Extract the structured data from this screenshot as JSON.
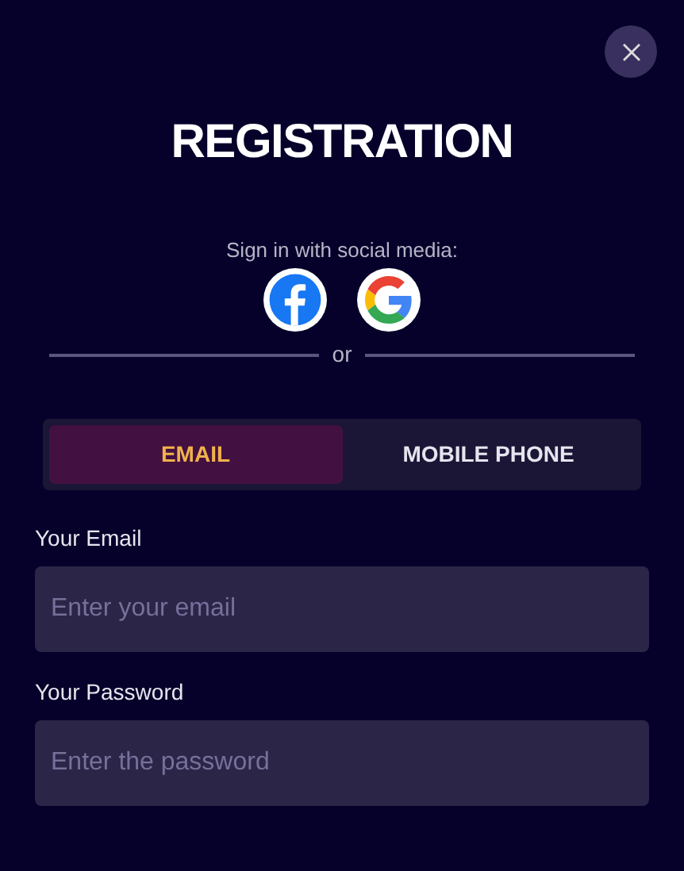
{
  "title": "REGISTRATION",
  "social": {
    "label": "Sign in with social media:",
    "providers": [
      {
        "kind": "facebook"
      },
      {
        "kind": "google"
      }
    ],
    "divider": "or"
  },
  "tabs": [
    {
      "label": "EMAIL",
      "selected": true
    },
    {
      "label": "MOBILE PHONE",
      "selected": false
    }
  ],
  "fields": [
    {
      "label": "Your Email",
      "placeholder": "Enter your email"
    },
    {
      "label": "Your Password",
      "placeholder": "Enter the password"
    }
  ]
}
